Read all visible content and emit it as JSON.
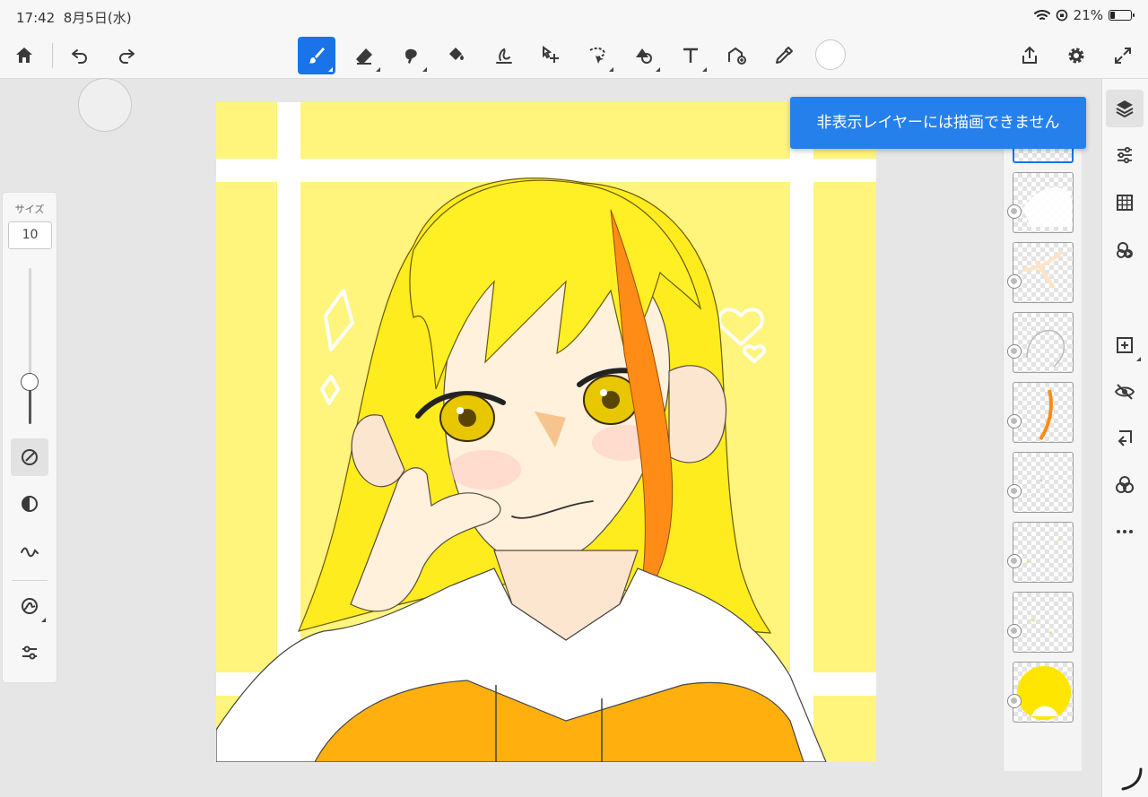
{
  "status_bar": {
    "time": "17:42",
    "date": "8月5日(水)",
    "battery_percent": "21%",
    "battery_level": 0.21
  },
  "toolbar": {
    "tools": [
      {
        "icon": "home-icon"
      },
      {
        "icon": "undo-icon"
      },
      {
        "icon": "redo-icon"
      },
      {
        "icon": "brush-icon",
        "active": true
      },
      {
        "icon": "eraser-icon"
      },
      {
        "icon": "smudge-icon"
      },
      {
        "icon": "fill-icon"
      },
      {
        "icon": "liquify-icon"
      },
      {
        "icon": "transform-icon"
      },
      {
        "icon": "lasso-select-icon"
      },
      {
        "icon": "shape-icon"
      },
      {
        "icon": "text-icon"
      },
      {
        "icon": "image-import-icon"
      },
      {
        "icon": "eyedropper-icon"
      },
      {
        "icon": "share-icon"
      },
      {
        "icon": "gear-icon"
      },
      {
        "icon": "fullscreen-icon"
      }
    ],
    "current_color": "#ffffff",
    "accent_color": "#1a73e8"
  },
  "brush_panel": {
    "size_label": "サイズ",
    "size_value": "10",
    "size_slider_level": 0.27
  },
  "canvas": {
    "background_color": "#fff36a",
    "grid_color": "#ffffff"
  },
  "layers_panel": {
    "layer_count": 9,
    "selected_index": 0
  },
  "right_sidebar": {
    "tools": [
      {
        "icon": "layers-icon",
        "active": true
      },
      {
        "icon": "adjustments-icon"
      },
      {
        "icon": "grid-icon"
      },
      {
        "icon": "blend-icon"
      },
      {
        "icon": "add-layer-icon"
      },
      {
        "icon": "hide-layer-icon"
      },
      {
        "icon": "merge-down-icon"
      },
      {
        "icon": "blend-mode-icon"
      },
      {
        "icon": "more-icon"
      }
    ]
  },
  "toast": {
    "message": "非表示レイヤーには描画できません",
    "color": "#2680eb"
  }
}
